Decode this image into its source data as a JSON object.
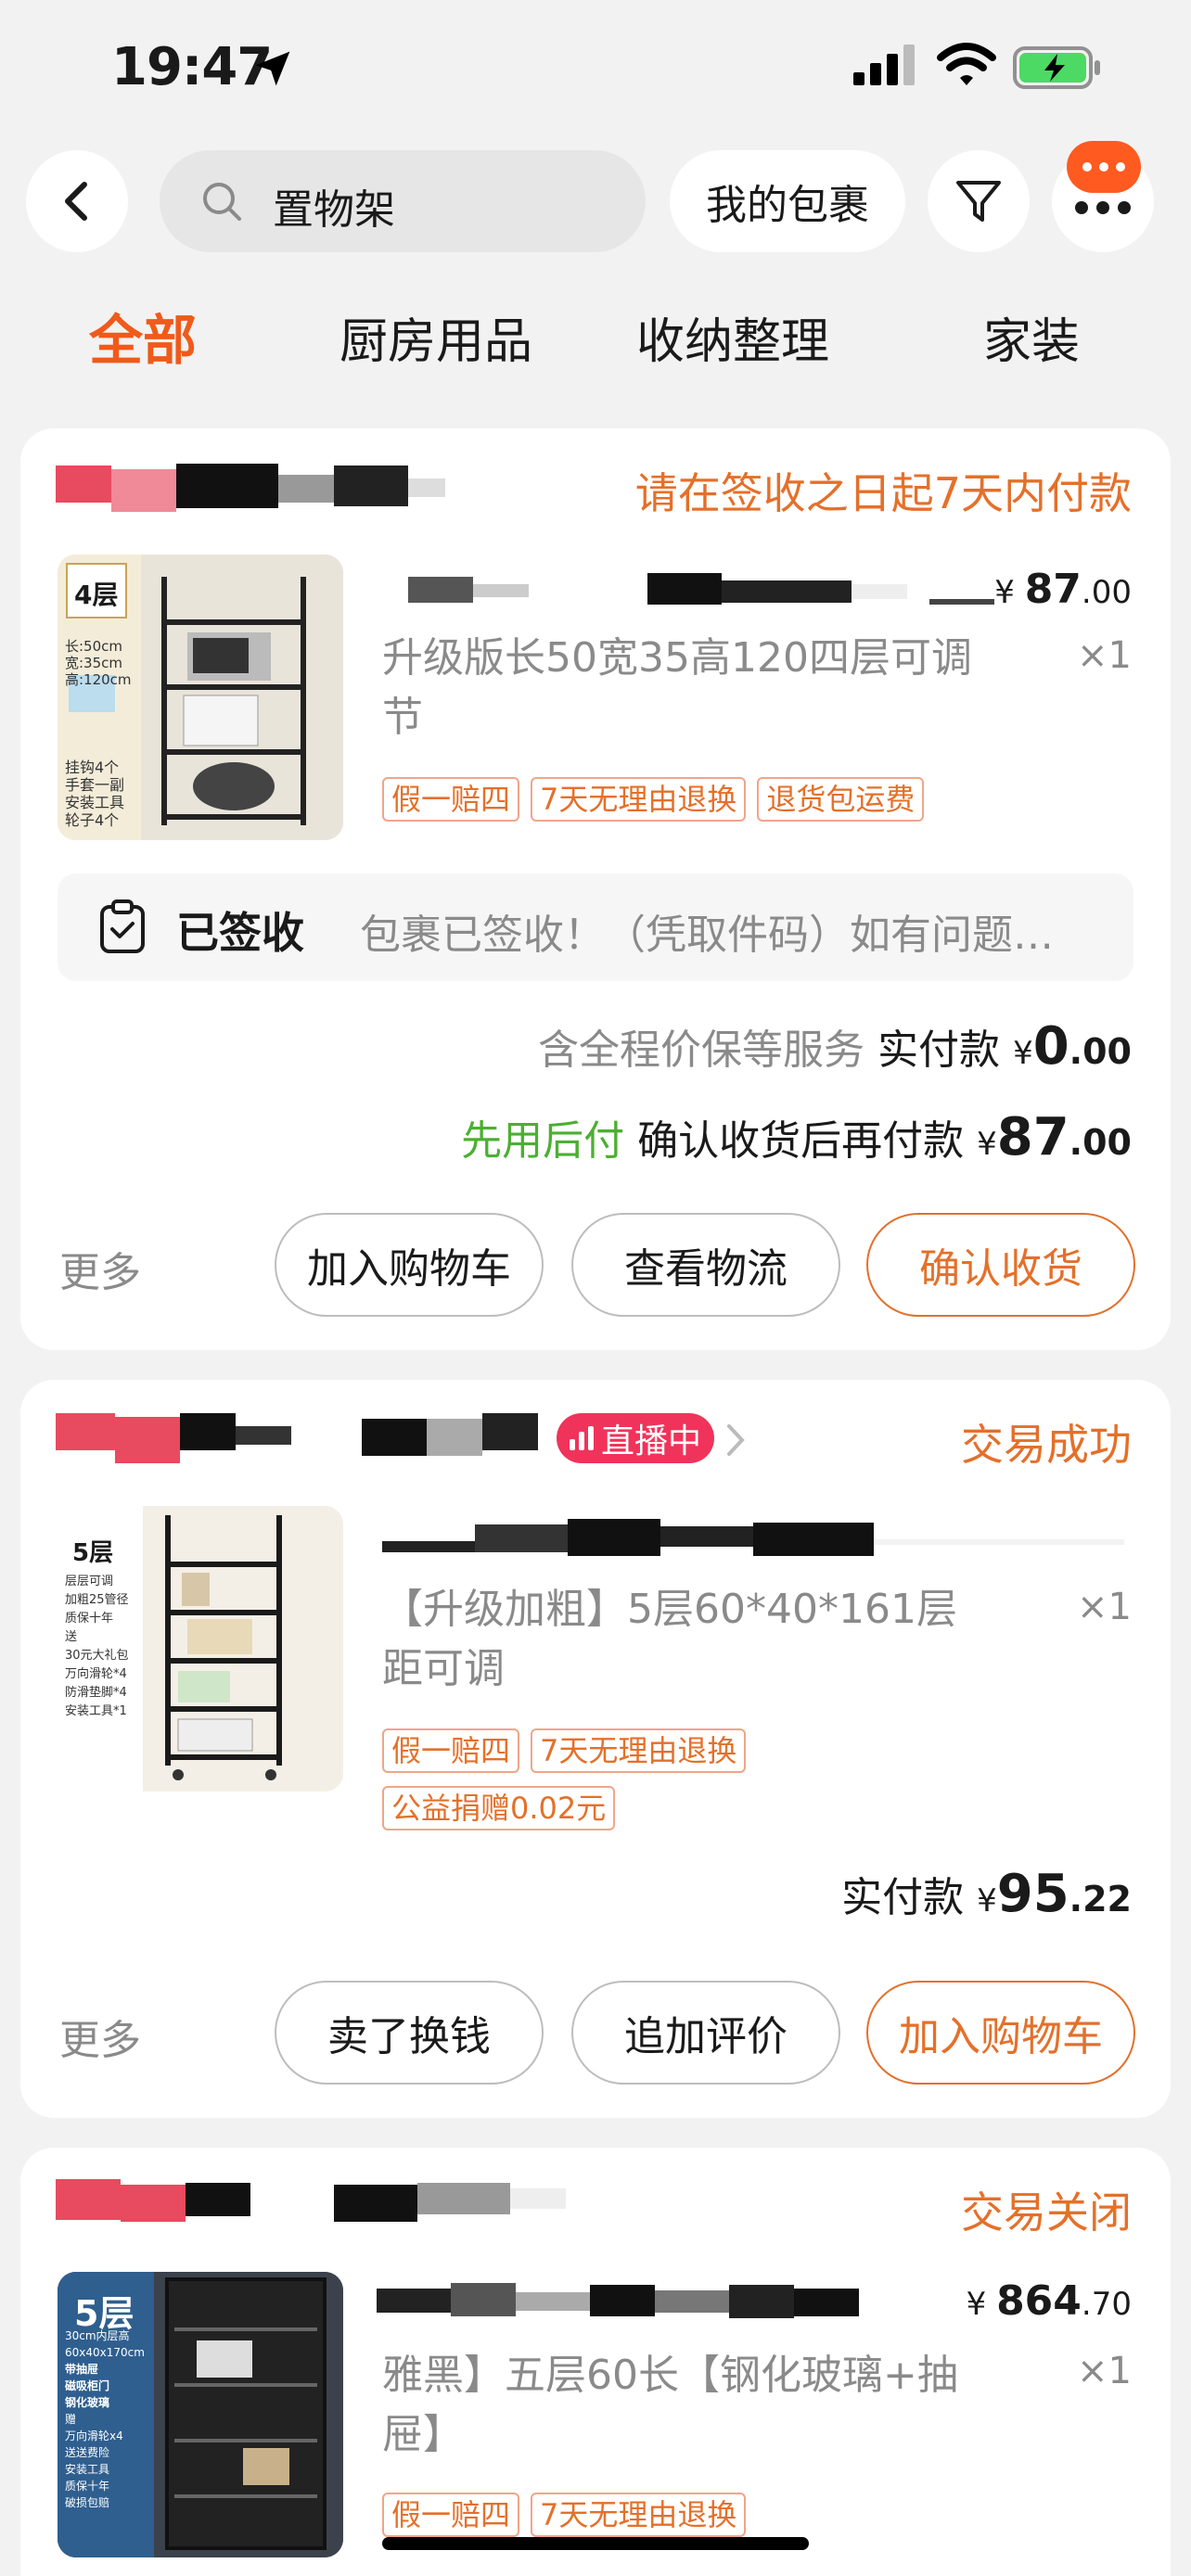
{
  "status_bar": {
    "time": "19:47"
  },
  "header": {
    "search_query": "置物架",
    "my_packages": "我的包裹"
  },
  "tabs": [
    "全部",
    "厨房用品",
    "收纳整理",
    "家装"
  ],
  "orders": [
    {
      "status": "请在签收之日起7天内付款",
      "price_symbol": "¥",
      "price_int": "87",
      "price_dec": ".00",
      "title": "升级版长50宽35高120四层可调节",
      "qty": "×1",
      "tags": [
        "假一赔四",
        "7天无理由退换",
        "退货包运费"
      ],
      "thumb_text": [
        "4层",
        "长:50cm",
        "宽:35cm",
        "高:120cm",
        "挂钩4个",
        "手套一副",
        "安装工具",
        "轮子4个"
      ],
      "delivery_label": "已签收",
      "delivery_text": "包裹已签收！（凭取件码）如有问题…",
      "service_label": "含全程价保等服务",
      "paid_label": "实付款",
      "paid_symbol": "¥",
      "paid_int": "0",
      "paid_dec": ".00",
      "bnpl_label": "先用后付",
      "confirm_pay_label": "确认收货后再付款",
      "confirm_symbol": "¥",
      "confirm_int": "87",
      "confirm_dec": ".00",
      "more": "更多",
      "buttons": [
        "加入购物车",
        "查看物流",
        "确认收货"
      ]
    },
    {
      "status": "交易成功",
      "live_label": "直播中",
      "title": "【升级加粗】5层60*40*161层距可调",
      "qty": "×1",
      "tags": [
        "假一赔四",
        "7天无理由退换",
        "公益捐赠0.02元"
      ],
      "thumb_text": [
        "5层",
        "层层可调",
        "加粗25管径",
        "质保十年",
        "送",
        "30元大礼包",
        "万向滑轮*4",
        "防滑垫脚*4",
        "安装工具*1"
      ],
      "paid_label": "实付款",
      "paid_symbol": "¥",
      "paid_int": "95",
      "paid_dec": ".22",
      "more": "更多",
      "buttons": [
        "卖了换钱",
        "追加评价",
        "加入购物车"
      ]
    },
    {
      "status": "交易关闭",
      "price_symbol": "¥",
      "price_int": "864",
      "price_dec": ".70",
      "title": "雅黑】五层60长【钢化玻璃+抽屉】",
      "qty": "×1",
      "tags": [
        "假一赔四",
        "7天无理由退换"
      ],
      "thumb_text": [
        "5层",
        "30cm内层高",
        "60x40x170cm",
        "带抽屉",
        "磁吸柜门",
        "钢化玻璃",
        "赠",
        "万向滑轮x4",
        "送送费险",
        "安装工具",
        "质保十年",
        "破损包赔"
      ]
    }
  ],
  "colors": {
    "accent": "#e4702a",
    "tab_active": "#f05a1a",
    "green": "#4caf33",
    "live": "#f0335a"
  }
}
